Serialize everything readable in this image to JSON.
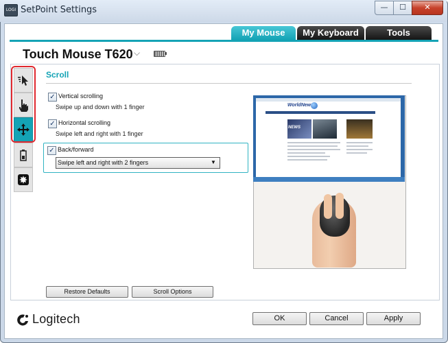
{
  "window": {
    "title": "SetPoint Settings",
    "icon_name": "setpoint-app-icon",
    "icon_text": "LOGI",
    "controls": {
      "minimize": "—",
      "maximize": "☐",
      "close": "✕"
    }
  },
  "top_tabs": [
    {
      "label": "My Mouse",
      "active": true
    },
    {
      "label": "My Keyboard",
      "active": false
    },
    {
      "label": "Tools",
      "active": false
    }
  ],
  "device": {
    "name": "Touch Mouse T620",
    "dropdown_icon": "chevron-down-icon",
    "dropdown_glyph": "⌵",
    "battery_icon": "battery-icon"
  },
  "side_tabs": [
    {
      "name": "pointer-icon",
      "active": false
    },
    {
      "name": "hand-gesture-icon",
      "active": false
    },
    {
      "name": "scroll-move-icon",
      "active": true
    },
    {
      "name": "battery-icon",
      "active": false
    },
    {
      "name": "settings-icon",
      "active": false
    }
  ],
  "section": {
    "title": "Scroll",
    "options": [
      {
        "label": "Vertical scrolling",
        "checked": true,
        "description": "Swipe up and down with 1 finger"
      },
      {
        "label": "Horizontal scrolling",
        "checked": true,
        "description": "Swipe left and right with 1 finger"
      },
      {
        "label": "Back/forward",
        "checked": true,
        "selected": "Swipe left and right with 2 fingers",
        "dropdown_glyph": "▼"
      }
    ],
    "check_glyph": "✓"
  },
  "preview": {
    "logo_text": "WorldNews",
    "headline": "NEWS"
  },
  "buttons": {
    "restore_defaults": "Restore Defaults",
    "scroll_options": "Scroll Options",
    "ok": "OK",
    "cancel": "Cancel",
    "apply": "Apply"
  },
  "brand": {
    "name": "Logitech"
  },
  "colors": {
    "accent": "#14a3b5",
    "highlight": "#e0282e",
    "dark_tab": "#151515"
  }
}
